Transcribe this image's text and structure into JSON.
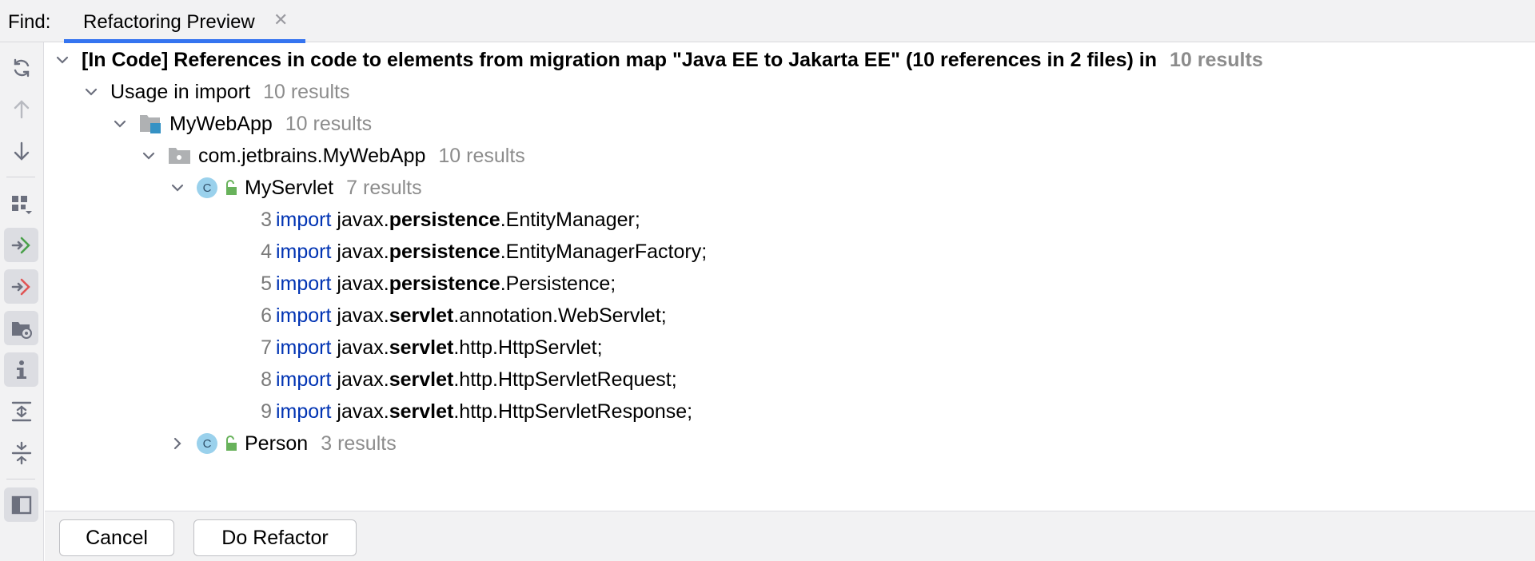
{
  "tabbar": {
    "find_label": "Find:",
    "active_tab": "Refactoring Preview"
  },
  "colors": {
    "accent": "#3574f0",
    "keyword": "#0033b3",
    "muted_count": "#8c8c8c",
    "class_icon": "#9ad1ec",
    "lock_icon": "#68b25b"
  },
  "toolbar": {
    "icons": [
      "refresh-icon",
      "arrow-up-icon",
      "arrow-down-icon",
      "group-by-icon",
      "include-icon",
      "exclude-icon",
      "folder-settings-icon",
      "info-icon",
      "expand-all-icon",
      "collapse-all-icon",
      "preview-panel-icon"
    ]
  },
  "tree": {
    "root": {
      "label": "[In Code] References in code to elements from migration map \"Java EE to Jakarta EE\"  (10 references in 2 files) in",
      "count": "10 results"
    },
    "usage": {
      "label": "Usage in import",
      "count": "10 results"
    },
    "module": {
      "label": "MyWebApp",
      "count": "10 results"
    },
    "package": {
      "label": "com.jetbrains.MyWebApp",
      "count": "10 results"
    },
    "servlet_class": {
      "label": "MyServlet",
      "count": "7 results"
    },
    "imports": [
      {
        "line": "3",
        "keyword": "import",
        "prefix": "javax.",
        "bold": "persistence",
        "rest": ".EntityManager;"
      },
      {
        "line": "4",
        "keyword": "import",
        "prefix": "javax.",
        "bold": "persistence",
        "rest": ".EntityManagerFactory;"
      },
      {
        "line": "5",
        "keyword": "import",
        "prefix": "javax.",
        "bold": "persistence",
        "rest": ".Persistence;"
      },
      {
        "line": "6",
        "keyword": "import",
        "prefix": "javax.",
        "bold": "servlet",
        "rest": ".annotation.WebServlet;"
      },
      {
        "line": "7",
        "keyword": "import",
        "prefix": "javax.",
        "bold": "servlet",
        "rest": ".http.HttpServlet;"
      },
      {
        "line": "8",
        "keyword": "import",
        "prefix": "javax.",
        "bold": "servlet",
        "rest": ".http.HttpServletRequest;"
      },
      {
        "line": "9",
        "keyword": "import",
        "prefix": "javax.",
        "bold": "servlet",
        "rest": ".http.HttpServletResponse;"
      }
    ],
    "person_class": {
      "label": "Person",
      "count": "3 results"
    },
    "class_icon_letter": "C"
  },
  "buttons": {
    "cancel": "Cancel",
    "do_refactor": "Do Refactor"
  }
}
